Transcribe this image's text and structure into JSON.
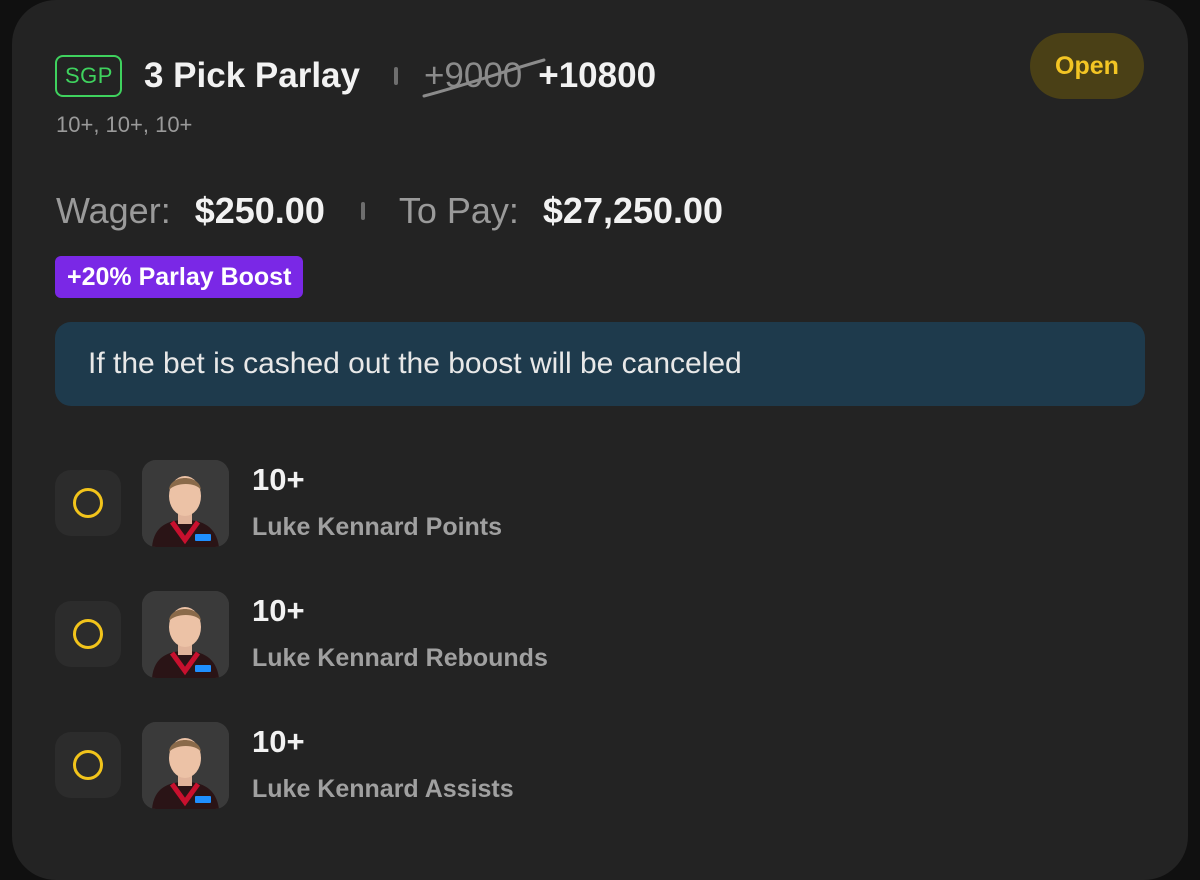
{
  "bet": {
    "type_badge": "SGP",
    "title": "3 Pick Parlay",
    "original_odds": "+9000",
    "boosted_odds": "+10800",
    "legs_summary": "10+, 10+, 10+",
    "status": "Open",
    "wager_label": "Wager:",
    "wager_value": "$250.00",
    "to_pay_label": "To Pay:",
    "to_pay_value": "$27,250.00",
    "boost_label": "+20% Parlay Boost",
    "notice": "If the bet is cashed out the boost will be canceled"
  },
  "picks": [
    {
      "line": "10+",
      "description": "Luke Kennard Points"
    },
    {
      "line": "10+",
      "description": "Luke Kennard Rebounds"
    },
    {
      "line": "10+",
      "description": "Luke Kennard Assists"
    }
  ],
  "colors": {
    "card_bg": "#232323",
    "sgp_green": "#3fd25e",
    "status_yellow": "#f3c524",
    "boost_purple": "#7a28e6",
    "notice_bg": "#1e3a4c",
    "pending_ring": "#f2c41b"
  }
}
